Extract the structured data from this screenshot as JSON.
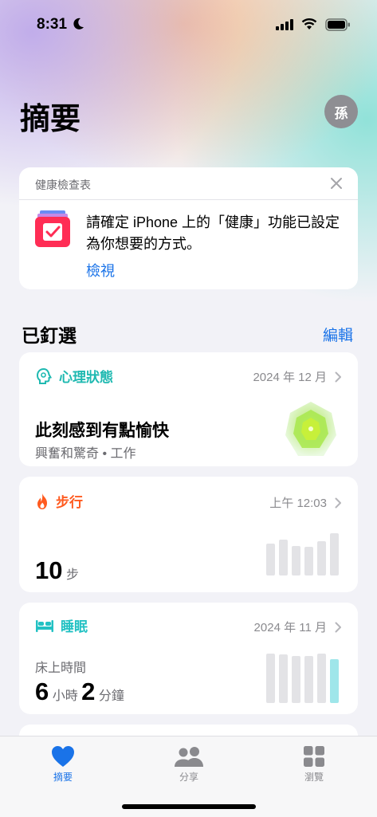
{
  "status_bar": {
    "time": "8:31"
  },
  "header": {
    "title": "摘要",
    "avatar_initial": "孫"
  },
  "health_checklist": {
    "title": "健康檢查表",
    "message": "請確定 iPhone 上的「健康」功能已設定為你想要的方式。",
    "link": "檢視"
  },
  "pinned": {
    "title": "已釘選",
    "edit_label": "編輯",
    "cards": [
      {
        "category": "心理狀態",
        "date": "2024 年 12 月",
        "main": "此刻感到有點愉快",
        "sub": "興奮和驚奇 • 工作",
        "color": "#1fb9b1"
      },
      {
        "category": "步行",
        "date": "上午 12:03",
        "value": "10",
        "unit": "步",
        "color": "#ff5a1f",
        "bar_levels": [
          0.72,
          0.8,
          0.66,
          0.64,
          0.76,
          0.94
        ]
      },
      {
        "category": "睡眠",
        "date": "2024 年 11 月",
        "label": "床上時間",
        "hours": "6",
        "hours_unit": "小時",
        "minutes": "2",
        "minutes_unit": "分鐘",
        "color": "#22c1c3",
        "bar_levels": [
          0.97,
          0.95,
          0.92,
          0.92,
          0.97,
          0.86
        ]
      }
    ]
  },
  "tabbar": {
    "items": [
      {
        "label": "摘要",
        "active": true
      },
      {
        "label": "分享",
        "active": false
      },
      {
        "label": "瀏覽",
        "active": false
      }
    ],
    "active_color": "#1a73e8",
    "inactive_color": "#8a8a8e"
  }
}
